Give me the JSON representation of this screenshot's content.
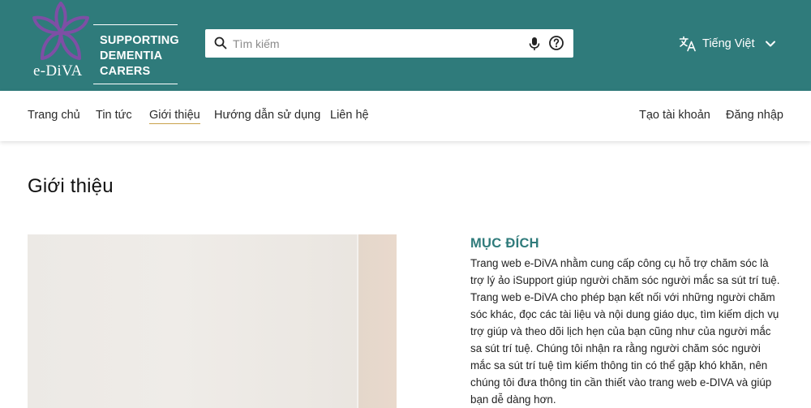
{
  "header": {
    "logo_text": "e-DiVA",
    "tagline": [
      "SUPPORTING",
      "DEMENTIA",
      "CARERS"
    ],
    "search": {
      "placeholder": "Tìm kiếm",
      "value": ""
    },
    "language": {
      "label": "Tiếng Việt"
    }
  },
  "nav": {
    "items": [
      {
        "label": "Trang chủ"
      },
      {
        "label": "Tin tức"
      },
      {
        "label": "Giới thiệu"
      },
      {
        "label": "Hướng dẫn sử dụng"
      },
      {
        "label": "Liên hệ"
      }
    ],
    "active": "Giới thiệu",
    "create_account": "Tạo tài khoản",
    "login": "Đăng nhập"
  },
  "main": {
    "title": "Giới thiệu",
    "section": {
      "heading": "MỤC ĐÍCH",
      "body": "Trang web e-DiVA nhằm cung cấp công cụ hỗ trợ chăm sóc là trợ lý ảo iSupport giúp người chăm sóc người mắc sa sút trí tuệ. Trang web e-DiVA cho phép bạn kết nối với những người chăm sóc khác, đọc các tài liệu và nội dung giáo dục, tìm kiếm dịch vụ trợ giúp và theo dõi lịch hẹn của bạn cũng như của người mắc sa sút trí tuệ. Chúng tôi nhận ra rằng người chăm sóc người mắc sa sút trí tuệ tìm kiếm thông tin có thể gặp khó khăn, nên chúng tôi đưa thông tin cần thiết vào trang web e-DIVA và giúp bạn dễ dàng hơn."
    }
  },
  "colors": {
    "brand_teal": "#2f7b7b",
    "logo_purple": "#7e4fa5",
    "active_underline": "#c9a24b"
  },
  "icons": {
    "logo": "flower-logo-icon",
    "search": "search-icon",
    "mic": "mic-icon",
    "help": "help-icon",
    "translate": "translate-icon",
    "chevron": "chevron-down-icon"
  }
}
